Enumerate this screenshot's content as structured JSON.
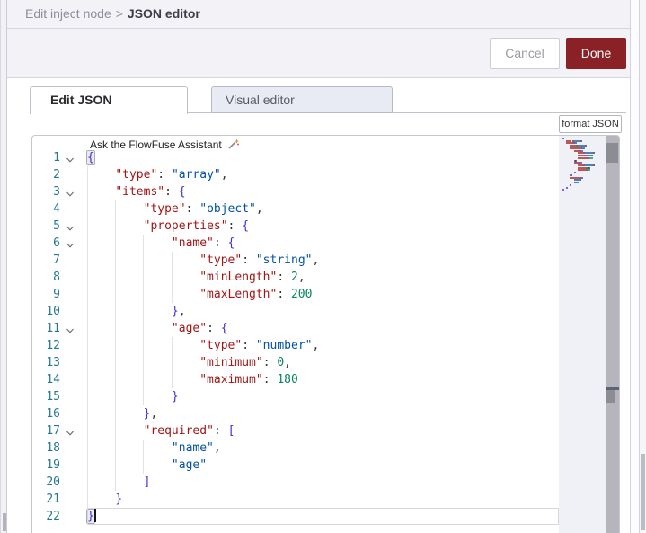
{
  "colors": {
    "accent_red": "#8a2126",
    "key": "#a31515",
    "string_value": "#0451a5",
    "number": "#098658",
    "bracket": "#3e32c7",
    "punct": "#333333",
    "line_number": "#237893"
  },
  "breadcrumb": {
    "parent": "Edit inject node",
    "separator": ">",
    "current": "JSON editor"
  },
  "buttons": {
    "cancel": "Cancel",
    "done": "Done",
    "format": "format JSON"
  },
  "tabs": [
    {
      "label": "Edit JSON",
      "active": true
    },
    {
      "label": "Visual editor",
      "active": false
    }
  ],
  "assistant": {
    "hint": "Ask the FlowFuse Assistant",
    "icon": "sparkle-pencil-icon"
  },
  "icons": {
    "fold": "chevron-down-icon",
    "assistant": "sparkle-pencil-icon"
  },
  "editor": {
    "cursor_line": 22,
    "lines": [
      {
        "n": 1,
        "fold": true,
        "tokens": [
          [
            "{",
            "b",
            "m"
          ]
        ]
      },
      {
        "n": 2,
        "tokens": [
          [
            "    ",
            ""
          ],
          [
            "\"type\"",
            "k"
          ],
          [
            ": ",
            "p"
          ],
          [
            "\"array\"",
            "s"
          ],
          [
            ",",
            "p"
          ]
        ]
      },
      {
        "n": 3,
        "fold": true,
        "tokens": [
          [
            "    ",
            ""
          ],
          [
            "\"items\"",
            "k"
          ],
          [
            ": ",
            "p"
          ],
          [
            "{",
            "b"
          ]
        ]
      },
      {
        "n": 4,
        "tokens": [
          [
            "        ",
            ""
          ],
          [
            "\"type\"",
            "k"
          ],
          [
            ": ",
            "p"
          ],
          [
            "\"object\"",
            "s"
          ],
          [
            ",",
            "p"
          ]
        ]
      },
      {
        "n": 5,
        "fold": true,
        "tokens": [
          [
            "        ",
            ""
          ],
          [
            "\"properties\"",
            "k"
          ],
          [
            ": ",
            "p"
          ],
          [
            "{",
            "b"
          ]
        ]
      },
      {
        "n": 6,
        "fold": true,
        "tokens": [
          [
            "            ",
            ""
          ],
          [
            "\"name\"",
            "k"
          ],
          [
            ": ",
            "p"
          ],
          [
            "{",
            "b"
          ]
        ]
      },
      {
        "n": 7,
        "tokens": [
          [
            "                ",
            ""
          ],
          [
            "\"type\"",
            "k"
          ],
          [
            ": ",
            "p"
          ],
          [
            "\"string\"",
            "s"
          ],
          [
            ",",
            "p"
          ]
        ]
      },
      {
        "n": 8,
        "tokens": [
          [
            "                ",
            ""
          ],
          [
            "\"minLength\"",
            "k"
          ],
          [
            ": ",
            "p"
          ],
          [
            "2",
            "n"
          ],
          [
            ",",
            "p"
          ]
        ]
      },
      {
        "n": 9,
        "tokens": [
          [
            "                ",
            ""
          ],
          [
            "\"maxLength\"",
            "k"
          ],
          [
            ": ",
            "p"
          ],
          [
            "200",
            "n"
          ]
        ]
      },
      {
        "n": 10,
        "tokens": [
          [
            "            ",
            ""
          ],
          [
            "}",
            "b"
          ],
          [
            ",",
            "p"
          ]
        ]
      },
      {
        "n": 11,
        "fold": true,
        "tokens": [
          [
            "            ",
            ""
          ],
          [
            "\"age\"",
            "k"
          ],
          [
            ": ",
            "p"
          ],
          [
            "{",
            "b"
          ]
        ]
      },
      {
        "n": 12,
        "tokens": [
          [
            "                ",
            ""
          ],
          [
            "\"type\"",
            "k"
          ],
          [
            ": ",
            "p"
          ],
          [
            "\"number\"",
            "s"
          ],
          [
            ",",
            "p"
          ]
        ]
      },
      {
        "n": 13,
        "tokens": [
          [
            "                ",
            ""
          ],
          [
            "\"minimum\"",
            "k"
          ],
          [
            ": ",
            "p"
          ],
          [
            "0",
            "n"
          ],
          [
            ",",
            "p"
          ]
        ]
      },
      {
        "n": 14,
        "tokens": [
          [
            "                ",
            ""
          ],
          [
            "\"maximum\"",
            "k"
          ],
          [
            ": ",
            "p"
          ],
          [
            "180",
            "n"
          ]
        ]
      },
      {
        "n": 15,
        "tokens": [
          [
            "            ",
            ""
          ],
          [
            "}",
            "b"
          ]
        ]
      },
      {
        "n": 16,
        "tokens": [
          [
            "        ",
            ""
          ],
          [
            "}",
            "b"
          ],
          [
            ",",
            "p"
          ]
        ]
      },
      {
        "n": 17,
        "fold": true,
        "tokens": [
          [
            "        ",
            ""
          ],
          [
            "\"required\"",
            "k"
          ],
          [
            ": ",
            "p"
          ],
          [
            "[",
            "b"
          ]
        ]
      },
      {
        "n": 18,
        "tokens": [
          [
            "            ",
            ""
          ],
          [
            "\"name\"",
            "s"
          ],
          [
            ",",
            "p"
          ]
        ]
      },
      {
        "n": 19,
        "tokens": [
          [
            "            ",
            ""
          ],
          [
            "\"age\"",
            "s"
          ]
        ]
      },
      {
        "n": 20,
        "tokens": [
          [
            "        ",
            ""
          ],
          [
            "]",
            "b"
          ]
        ]
      },
      {
        "n": 21,
        "tokens": [
          [
            "    ",
            ""
          ],
          [
            "}",
            "b"
          ]
        ]
      },
      {
        "n": 22,
        "tokens": [
          [
            "}",
            "b",
            "m"
          ]
        ]
      }
    ]
  }
}
